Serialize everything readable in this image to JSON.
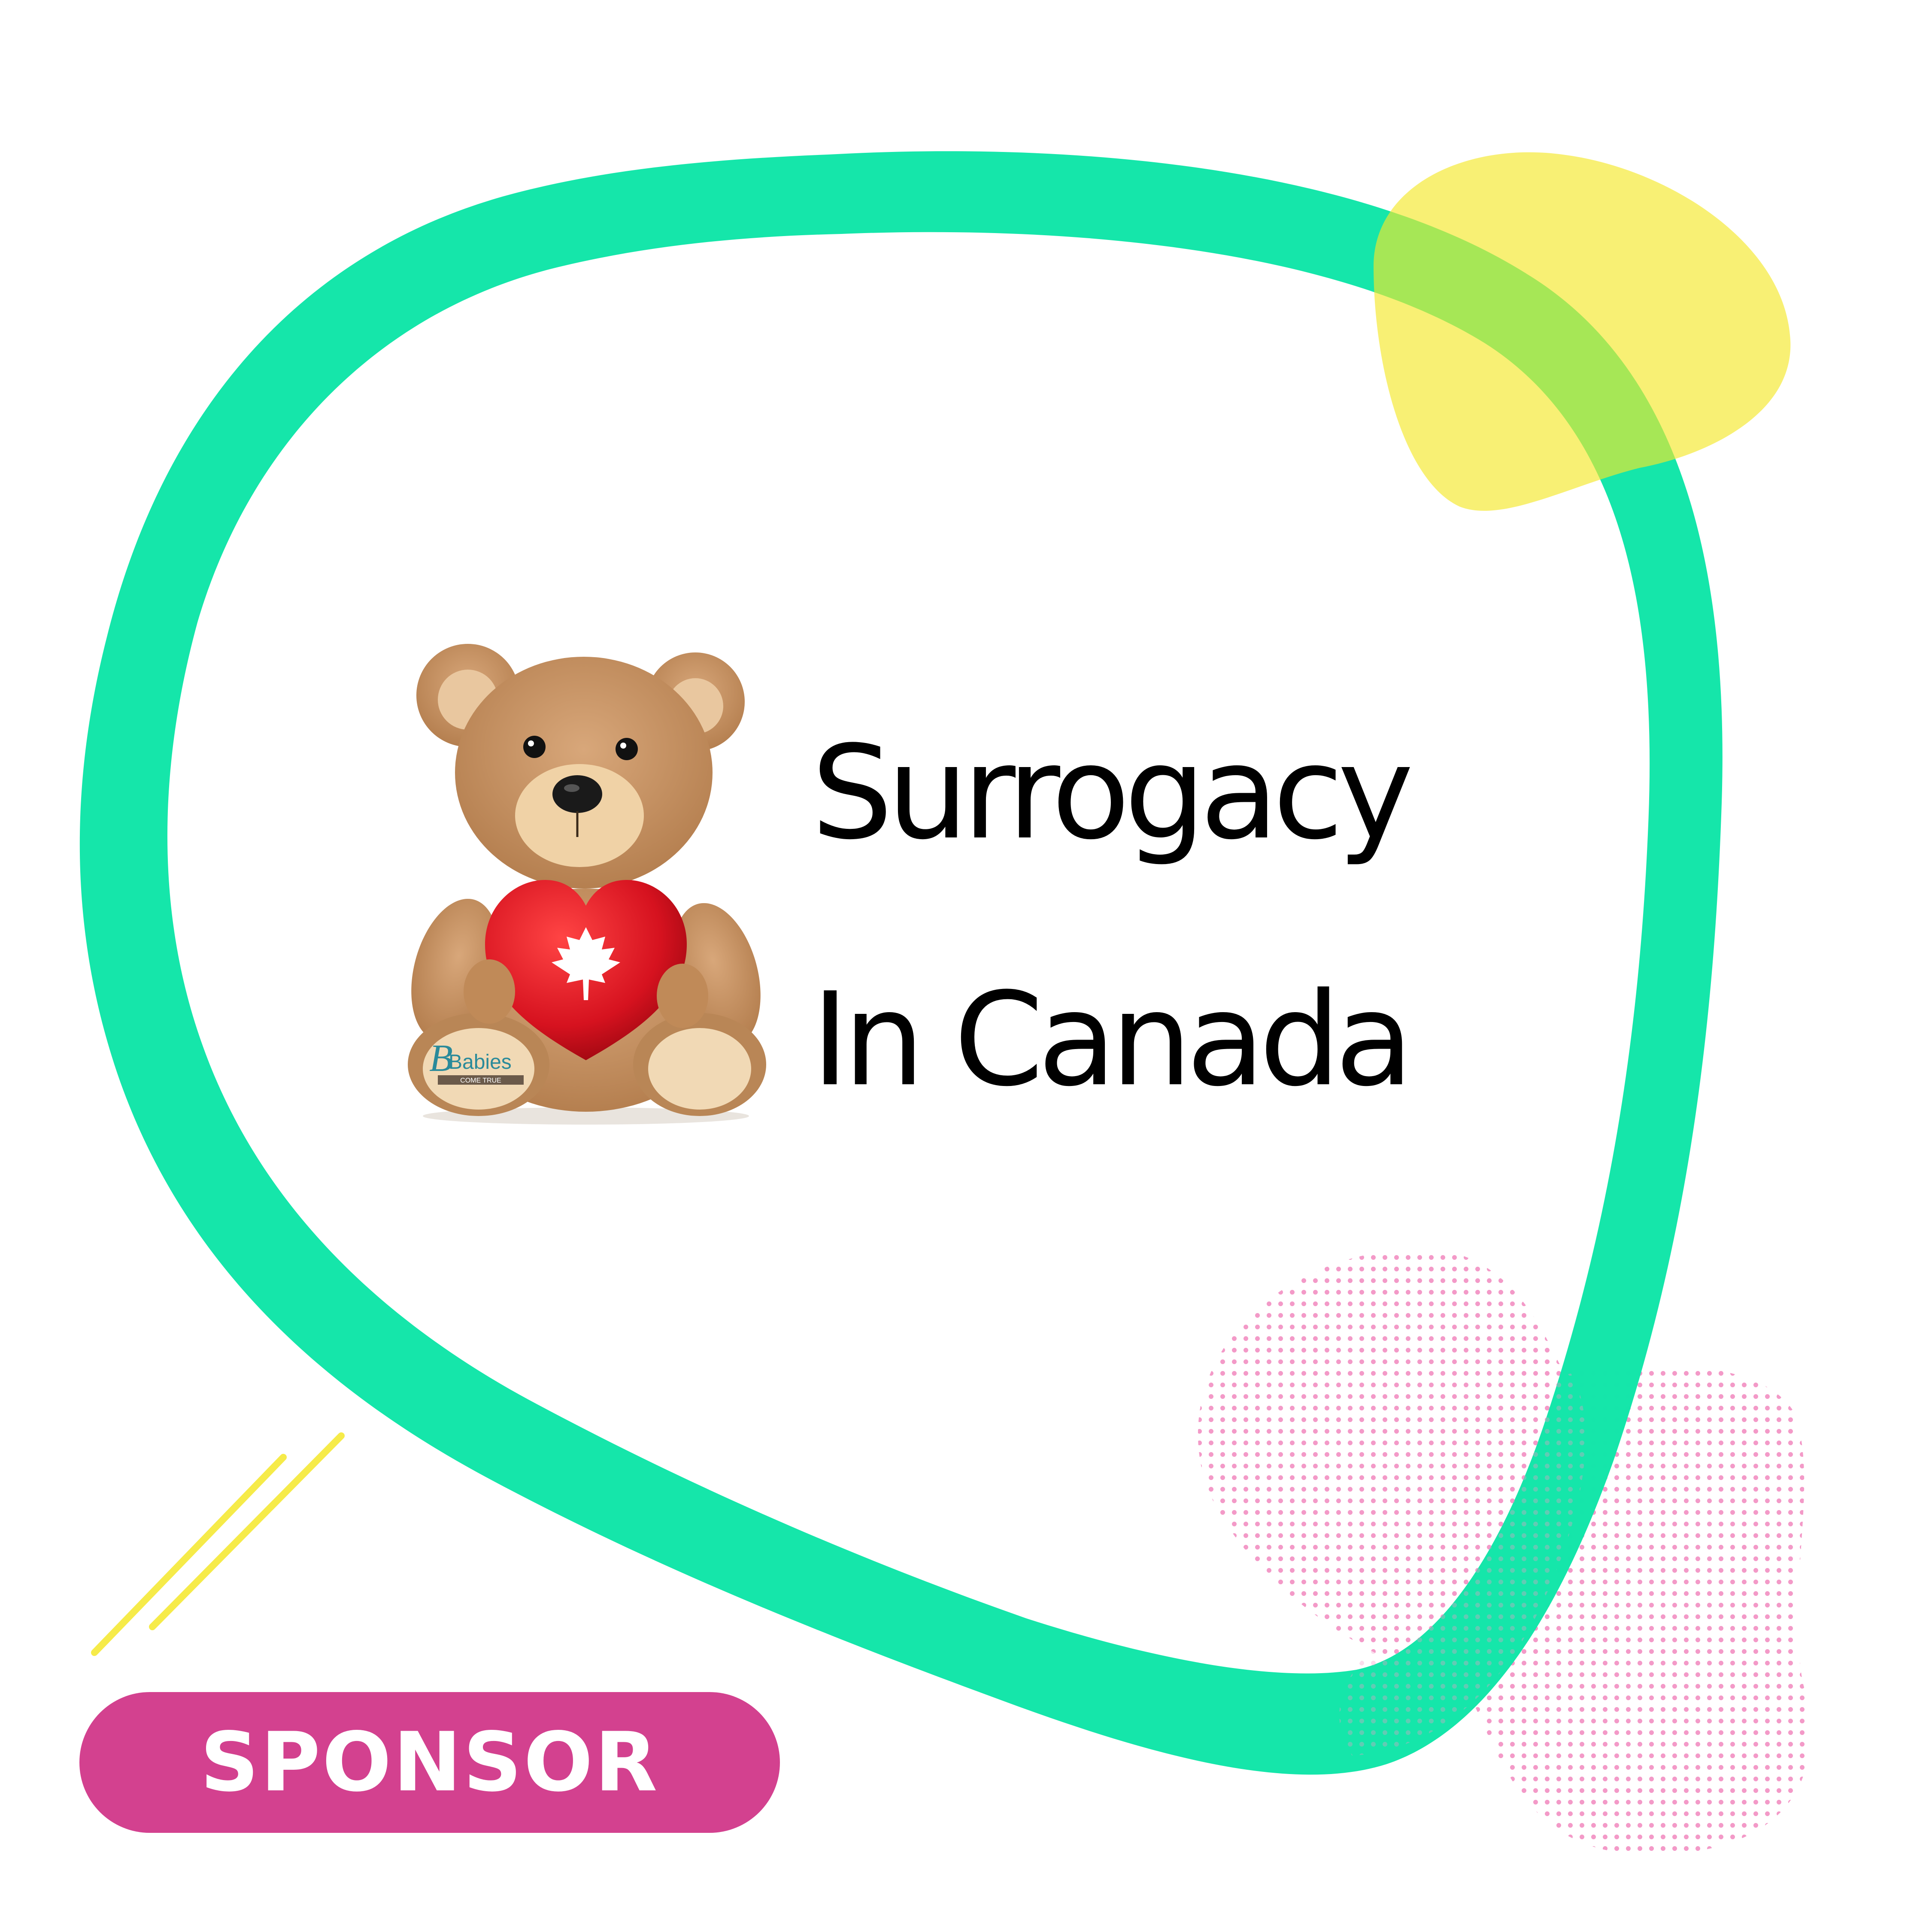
{
  "title": {
    "line1": "Surrogacy",
    "line2": "In Canada"
  },
  "badge": {
    "label": "SPONSOR"
  },
  "bear": {
    "logo_text": "Babies",
    "logo_tagline": "COME TRUE",
    "heart_icon": "maple-leaf-icon"
  },
  "colors": {
    "ring": "#12e6a9",
    "yellow_blob": "#f4e829",
    "pink_dots": "#f39ac8",
    "badge": "#d3418f",
    "text": "#000000"
  }
}
